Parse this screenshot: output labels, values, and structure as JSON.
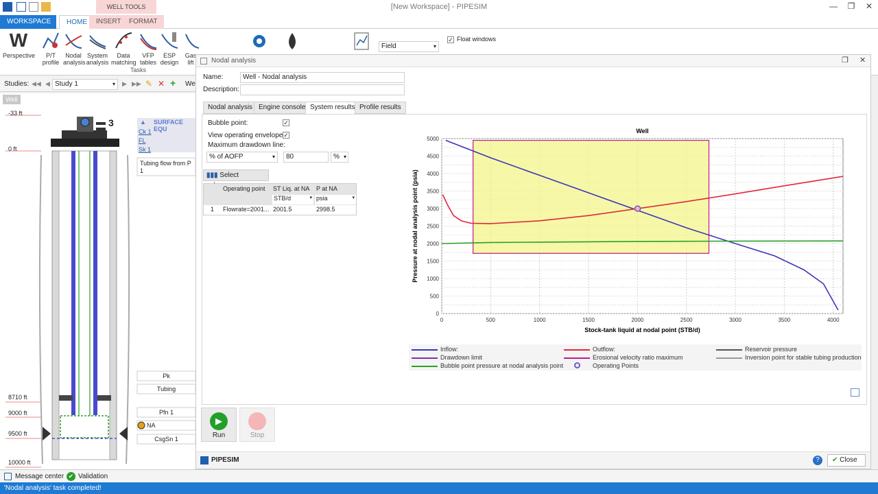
{
  "window": {
    "title": "[New Workspace] - PIPESIM",
    "well_tools_label": "WELL TOOLS"
  },
  "ribbon": {
    "tabs": [
      "WORKSPACE",
      "HOME",
      "INSERT",
      "FORMAT"
    ],
    "buttons": [
      {
        "label": "Perspective",
        "icon": "perspective-icon"
      },
      {
        "label": "P/T profile",
        "icon": "pt-profile-icon"
      },
      {
        "label": "Nodal analysis",
        "icon": "nodal-analysis-icon"
      },
      {
        "label": "System analysis",
        "icon": "system-analysis-icon"
      },
      {
        "label": "Data matching",
        "icon": "data-matching-icon"
      },
      {
        "label": "VFP tables",
        "icon": "vfp-tables-icon"
      },
      {
        "label": "ESP design",
        "icon": "esp-design-icon"
      },
      {
        "label": "Gas lift",
        "icon": "gas-lift-icon"
      }
    ],
    "group_label": "Tasks",
    "field_dropdown": "Field",
    "float_windows": "Float windows"
  },
  "studies": {
    "label": "Studies:",
    "selected": "Study 1",
    "extra": "We"
  },
  "left_pane": {
    "tab": "Well",
    "depths": [
      "-33 ft",
      "0 ft",
      "8710 ft",
      "9000 ft",
      "9500 ft",
      "10000 ft"
    ],
    "surface_label": "SURFACE EQU",
    "links": [
      "Ck 1",
      "FL",
      "Sk 1"
    ],
    "tooltip": "Tubing flow from P",
    "tooltip_sub": "1",
    "wellhead_number": "3",
    "components": [
      "Pk",
      "Tubing",
      "Pfn 1",
      "NA",
      "CsgSn 1"
    ]
  },
  "dialog": {
    "title": "Nodal analysis",
    "name_label": "Name:",
    "name_value": "Well - Nodal analysis",
    "description_label": "Description:",
    "tabs": [
      "Nodal analysis",
      "Engine console",
      "System results",
      "Profile results"
    ],
    "bubble_point": "Bubble point:",
    "view_envelope": "View operating envelope:",
    "max_drawdown": "Maximum drawdown line:",
    "drawdown_unit": "% of AOFP",
    "drawdown_value": "80",
    "drawdown_pct": "%",
    "select_columns": "Select columns...",
    "table": {
      "headers": [
        "Operating point",
        "ST Liq. at NA",
        "P at NA"
      ],
      "units": [
        "STB/d",
        "psia"
      ],
      "rows": [
        [
          "1",
          "Flowrate=2001...",
          "2001.5",
          "2998.5"
        ]
      ]
    },
    "run": "Run",
    "stop": "Stop",
    "brand": "PIPESIM",
    "close": "Close"
  },
  "legend": [
    {
      "label": "Inflow:",
      "color": "#3b35b8"
    },
    {
      "label": "Outflow:",
      "color": "#e0283c"
    },
    {
      "label": "Reservoir pressure",
      "color": "#555555"
    },
    {
      "label": "Drawdown limit",
      "color": "#7d2fb0"
    },
    {
      "label": "Erosional velocity ratio maximum",
      "color": "#c2188b"
    },
    {
      "label": "Inversion point for stable tubing production",
      "color": "#999999"
    },
    {
      "label": "Bubble point pressure at nodal analysis point",
      "color": "#2aa02a"
    },
    {
      "label": "Operating Points",
      "color": "#6b5bc9"
    }
  ],
  "chart_data": {
    "type": "line",
    "title": "Well",
    "xlabel": "Stock-tank liquid at nodal point (STB/d)",
    "ylabel": "Pressure at nodal analysis point (psia)",
    "xlim": [
      0,
      4100
    ],
    "ylim": [
      0,
      5000
    ],
    "x_ticks": [
      0,
      500,
      1000,
      1500,
      2000,
      2500,
      3000,
      3500,
      4000
    ],
    "y_ticks": [
      0,
      250,
      500,
      750,
      1000,
      1250,
      1500,
      1750,
      2000,
      2250,
      2500,
      2750,
      3000,
      3250,
      3500,
      3750,
      4000,
      4250,
      4500,
      4750,
      5000
    ],
    "envelope": {
      "x": [
        320,
        2730
      ],
      "y": [
        1720,
        4950
      ]
    },
    "series": [
      {
        "name": "Inflow",
        "color": "#3b35b8",
        "x": [
          40,
          500,
          1000,
          1500,
          2000,
          2500,
          3000,
          3400,
          3700,
          3900,
          4050
        ],
        "y": [
          4950,
          4450,
          3950,
          3450,
          2950,
          2450,
          2000,
          1650,
          1250,
          850,
          100
        ]
      },
      {
        "name": "Outflow",
        "color": "#e0283c",
        "x": [
          10,
          60,
          120,
          200,
          300,
          500,
          1000,
          1500,
          2000,
          2500,
          3000,
          3500,
          4100
        ],
        "y": [
          3400,
          3100,
          2800,
          2650,
          2580,
          2570,
          2650,
          2800,
          2998,
          3200,
          3420,
          3650,
          3920
        ]
      },
      {
        "name": "Bubble point pressure at nodal analysis point",
        "color": "#2aa02a",
        "x": [
          0,
          500,
          1000,
          1500,
          2000,
          2500,
          3000,
          3500,
          4100
        ],
        "y": [
          2000,
          2030,
          2040,
          2050,
          2060,
          2065,
          2070,
          2072,
          2075
        ]
      }
    ],
    "operating_point": {
      "x": 2001.5,
      "y": 2998.5
    }
  },
  "status": {
    "message_center": "Message center",
    "validation": "Validation",
    "bottom": "'Nodal analysis' task completed!"
  }
}
